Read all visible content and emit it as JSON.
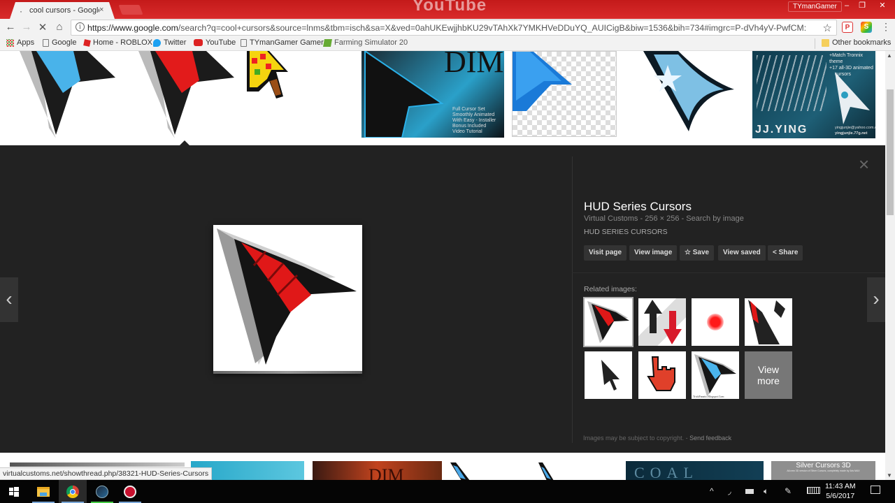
{
  "browser": {
    "tab_title": "cool cursors - Google Se",
    "tab_close": "×",
    "header_watermark": "YouTube",
    "profile_name": "TYmanGamer",
    "window_controls": {
      "minimize": "–",
      "restore": "❐",
      "close": "✕"
    },
    "url_scheme_host": "https://www.google.com",
    "url_path": "/search?q=cool+cursors&source=lnms&tbm=isch&sa=X&ved=0ahUKEwjjhbKU29vTAhXk7YMKHVeDDuYQ_AUICigB&biw=1536&bih=734#imgrc=P-dVh4yV-PwfCM:",
    "nav_icons": {
      "back": "arrow-left-icon",
      "forward": "arrow-right-icon",
      "stop": "stop-icon",
      "home": "home-icon"
    },
    "extensions": [
      {
        "name": "pdf-extension",
        "label": "P"
      },
      {
        "name": "s-extension",
        "label": "S"
      }
    ],
    "menu_icon": "⋮"
  },
  "bookmarks": {
    "items": [
      {
        "label": "Apps",
        "icon": "apps-grid-icon"
      },
      {
        "label": "Google",
        "icon": "page-icon"
      },
      {
        "label": "Home - ROBLOX",
        "icon": "roblox-icon"
      },
      {
        "label": "Twitter",
        "icon": "twitter-icon"
      },
      {
        "label": "YouTube",
        "icon": "youtube-icon"
      },
      {
        "label": "TYmanGamer Gamer",
        "icon": "page-icon"
      },
      {
        "label": "Farming Simulator 20",
        "icon": "farming-sim-icon"
      }
    ],
    "other": "Other bookmarks"
  },
  "top_strip": {
    "thumbs": [
      {
        "name": "blue-hud-cursor"
      },
      {
        "name": "red-hud-cursor",
        "selected": true
      },
      {
        "name": "pixel-cursor"
      },
      {
        "name": "dim-cursor-set",
        "lines": [
          "Full Cursor Set",
          "Smoothly Animated",
          "With Easy - Installer",
          "Bonus Included",
          "Video Tutorial"
        ],
        "title": "DIM"
      },
      {
        "name": "blue-pixel-arrow"
      },
      {
        "name": "star-trek-cursor"
      },
      {
        "name": "tronnix-cursors",
        "lines": [
          "+Match Tronnix theme",
          "+17 all-3D animated",
          "cursors"
        ],
        "footer": "JJ.YING",
        "footer_small": [
          "yingjunjie@yahoo.com.cn",
          "yingjunjie.77g.net"
        ]
      }
    ]
  },
  "viewer": {
    "title": "HUD Series Cursors",
    "source": "Virtual Customs",
    "dimensions": "256 × 256",
    "search_by_image": "Search by image",
    "description": "HUD SERIES CURSORS",
    "buttons": {
      "visit_page": "Visit page",
      "view_image": "View image",
      "save": "Save",
      "view_saved": "View saved",
      "share": "Share"
    },
    "related_label": "Related images:",
    "related": [
      {
        "name": "related-red-hud",
        "selected": true
      },
      {
        "name": "related-up-down-arrows"
      },
      {
        "name": "related-red-dot"
      },
      {
        "name": "related-feather-arrow"
      },
      {
        "name": "related-black-arrow"
      },
      {
        "name": "related-red-hand"
      },
      {
        "name": "related-blue-hud",
        "caption": "TrickFanatic.Blogspot.Com"
      },
      {
        "name": "related-view-more",
        "label_line1": "View",
        "label_line2": "more"
      }
    ],
    "copyright": "Images may be subject to copyright.",
    "send_feedback": "Send feedback",
    "prev_arrow": "‹",
    "next_arrow": "›",
    "close": "×"
  },
  "bottom_strip": {
    "thumbs": [
      {
        "name": "grey-gradient"
      },
      {
        "name": "blue-cursor-banner"
      },
      {
        "name": "dim-banner",
        "text": "DIM"
      },
      {
        "name": "pixel-blue-cursor-1"
      },
      {
        "name": "pixel-blue-cursor-2"
      },
      {
        "name": "coal-cursors",
        "text": "COAL"
      },
      {
        "name": "silver-cursors-3d",
        "text": "Silver Cursors 3D",
        "subtext": "All-new 3D version of Silver Cursors, completely made by 3ds MAX"
      }
    ]
  },
  "status_bar": {
    "url": "virtualcustoms.net/showthread.php/38321-HUD-Series-Cursors"
  },
  "taskbar": {
    "apps": [
      {
        "name": "start",
        "icon": "windows-icon"
      },
      {
        "name": "file-explorer",
        "icon": "folder-icon"
      },
      {
        "name": "chrome",
        "icon": "chrome-icon",
        "active": true
      },
      {
        "name": "steam",
        "icon": "steam-icon"
      },
      {
        "name": "record",
        "icon": "record-icon"
      }
    ],
    "tray": {
      "chevron": "^",
      "wifi": "wifi-icon",
      "battery": "battery-icon",
      "volume": "volume-icon",
      "pen": "pen-icon",
      "keyboard": "keyboard-icon",
      "notifications": "action-center-icon"
    },
    "time": "11:43 AM",
    "date": "5/6/2017"
  },
  "colors": {
    "chrome_red": "#c41a1a",
    "viewer_bg": "#222222",
    "button_bg": "#333333",
    "hud_red": "#e01818",
    "hud_blue": "#4ab4ec"
  }
}
